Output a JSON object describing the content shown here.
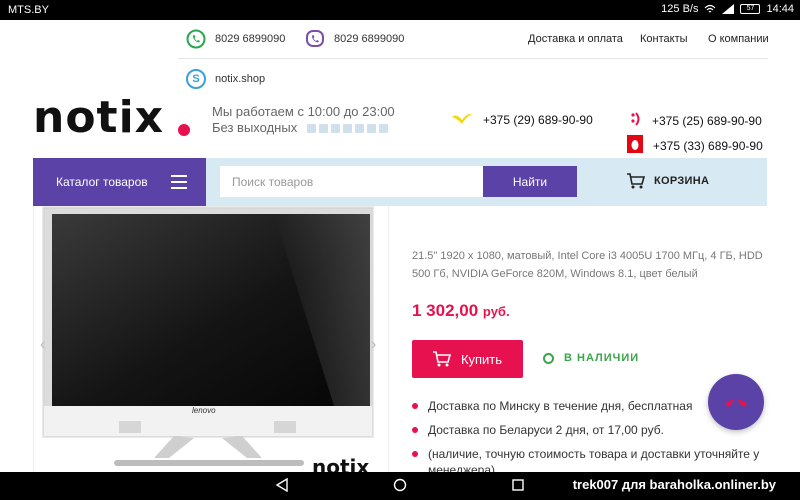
{
  "status": {
    "carrier": "MTS.BY",
    "speed": "125 B/s",
    "battery": "57",
    "time": "14:44"
  },
  "top": {
    "whatsapp_phone": "8029 6899090",
    "viber_phone": "8029 6899090",
    "nav": [
      "Доставка и оплата",
      "Контакты",
      "О компании"
    ],
    "shop_link": "notix.shop"
  },
  "header": {
    "logo": "notix",
    "hours_line1": "Мы работаем с 10:00 до 23:00",
    "hours_line2": "Без выходных",
    "phones": {
      "velcom": "+375 (29) 689-90-90",
      "life": "+375 (25) 689-90-90",
      "mts": "+375 (33) 689-90-90"
    }
  },
  "navbar": {
    "catalog_label": "Каталог товаров",
    "search_placeholder": "Поиск товаров",
    "search_button": "Найти",
    "cart_label": "КОРЗИНА"
  },
  "product": {
    "image_brand": "lenovo",
    "image_watermark": "notix",
    "specs": "21.5\" 1920 x 1080, матовый, Intel Core i3 4005U 1700 МГц, 4 ГБ, HDD 500 Гб, NVIDIA GeForce 820M, Windows 8.1, цвет белый",
    "price_value": "1 302,00",
    "price_currency": "руб.",
    "buy_label": "Купить",
    "stock_label": "В НАЛИЧИИ",
    "delivery": [
      "Доставка по Минску в течение дня, бесплатная",
      "Доставка по Беларуси 2 дня, от 17,00 руб.",
      "(наличие, точную стоимость товара и доставки уточняйте у менеджера)"
    ]
  },
  "watermark": "trek007 для baraholka.onliner.by",
  "colors": {
    "brand_purple": "#5a42a6",
    "accent_red": "#e8114f",
    "stock_green": "#3aa64a",
    "navbar_bg": "#d7e9f2"
  }
}
